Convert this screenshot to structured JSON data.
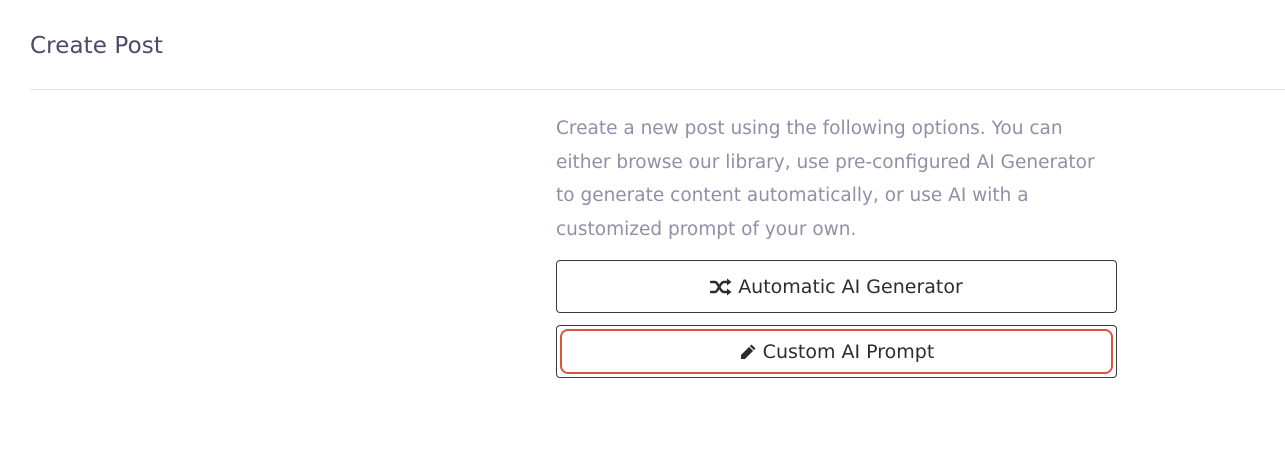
{
  "header": {
    "title": "Create Post"
  },
  "main": {
    "description": "Create a new post using the following options. You can either browse our library, use pre-configured AI Generator to generate content automatically, or use AI with a customized prompt of your own.",
    "buttons": [
      {
        "label": "Automatic AI Generator",
        "icon": "shuffle-icon"
      },
      {
        "label": "Custom AI Prompt",
        "icon": "pencil-icon"
      }
    ]
  },
  "colors": {
    "title": "#4a4a6a",
    "description": "#8f8fa8",
    "button_border": "#3a3a3a",
    "focus_highlight": "#d9553f"
  }
}
